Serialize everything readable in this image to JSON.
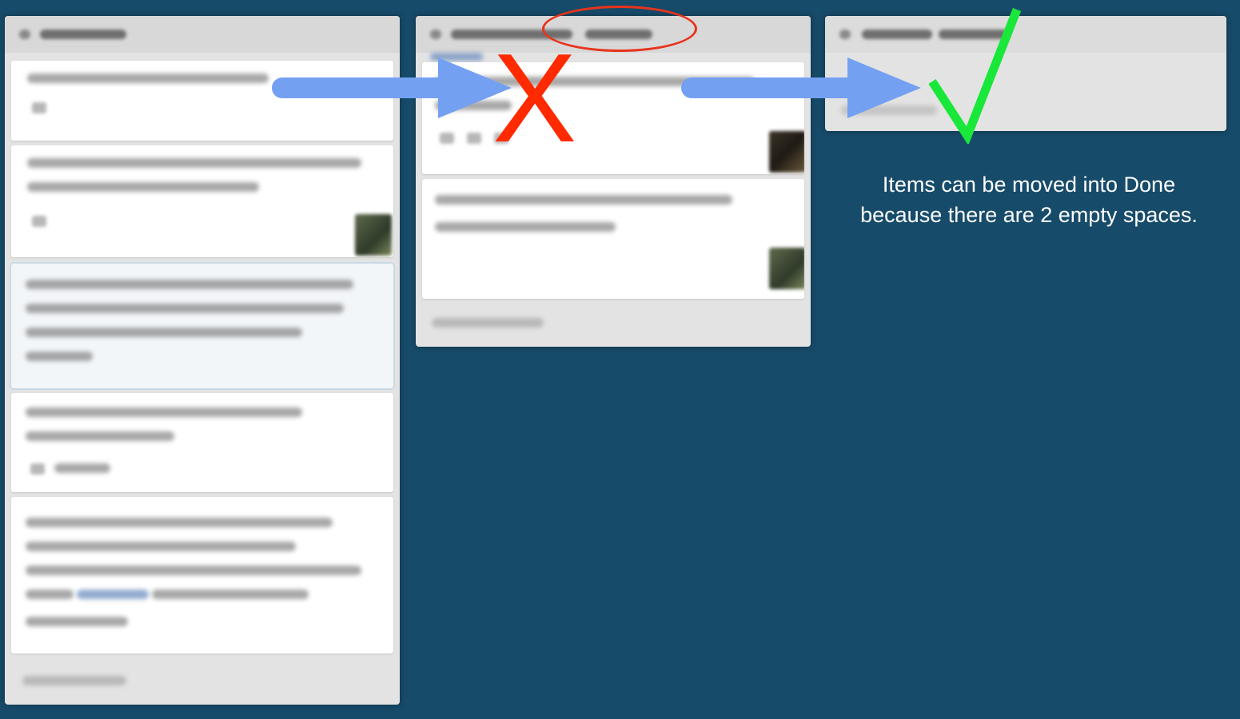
{
  "board": {
    "columns": [
      {
        "name": "pending-column",
        "cards": 5
      },
      {
        "name": "in-progress-column",
        "cards": 2
      },
      {
        "name": "done-column",
        "cards": 0
      }
    ]
  },
  "annotations": {
    "blocked_mark": "X",
    "allowed_mark": "check",
    "note_text": "Items can be moved into Done because there are 2 empty spaces.",
    "colors": {
      "arrow": "#74a0f2",
      "blocked": "#ff2a00",
      "allowed": "#19e83a",
      "board_background": "#174b6a"
    }
  }
}
